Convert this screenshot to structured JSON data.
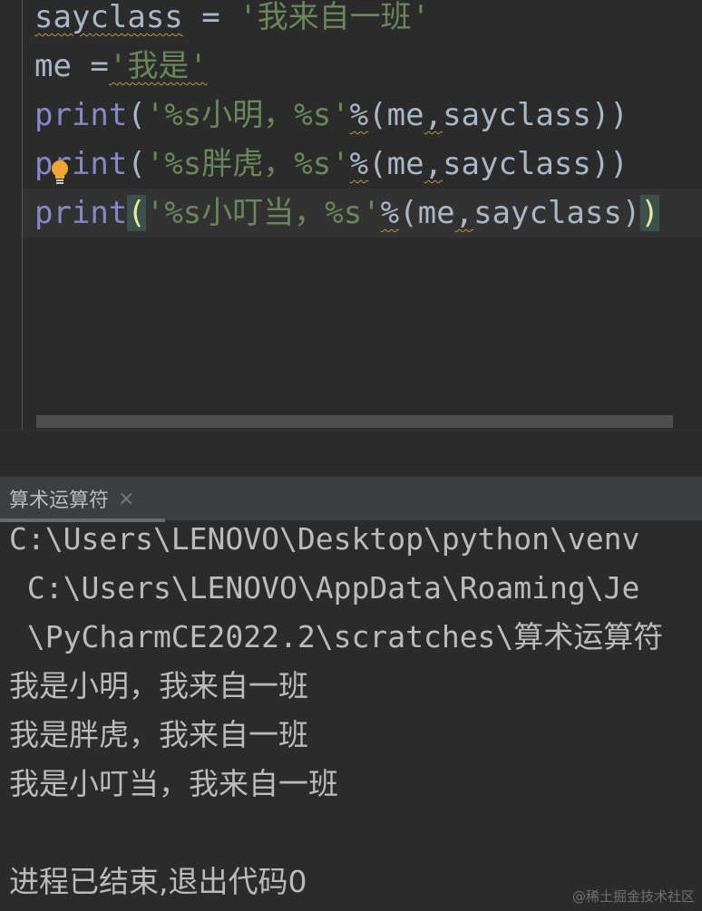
{
  "editor": {
    "lines": [
      {
        "parts": [
          {
            "t": "sayclass",
            "c": "id",
            "sq": true
          },
          {
            "t": " = ",
            "c": "id"
          },
          {
            "t": "'我来自一班'",
            "c": "str"
          }
        ]
      },
      {
        "parts": [
          {
            "t": "me",
            "c": "id"
          },
          {
            "t": " =",
            "c": "id"
          },
          {
            "t": "'我是'",
            "c": "str",
            "sq": true
          }
        ]
      },
      {
        "parts": [
          {
            "t": "print",
            "c": "kw"
          },
          {
            "t": "(",
            "c": "id"
          },
          {
            "t": "'%s小明，%s'",
            "c": "str"
          },
          {
            "t": "%",
            "c": "id",
            "sq": true
          },
          {
            "t": "(me",
            "c": "id"
          },
          {
            "t": ",",
            "c": "id",
            "sq": true
          },
          {
            "t": "sayclass))",
            "c": "id"
          }
        ]
      },
      {
        "parts": [
          {
            "t": "print",
            "c": "kw"
          },
          {
            "t": "(",
            "c": "id"
          },
          {
            "t": "'%s胖虎，%s'",
            "c": "str"
          },
          {
            "t": "%",
            "c": "id",
            "sq": true
          },
          {
            "t": "(me",
            "c": "id"
          },
          {
            "t": ",",
            "c": "id",
            "sq": true
          },
          {
            "t": "sayclass))",
            "c": "id"
          }
        ]
      },
      {
        "current": true,
        "parts": [
          {
            "t": "print",
            "c": "kw"
          },
          {
            "t": "(",
            "c": "brace"
          },
          {
            "t": "'%s小叮当，%s'",
            "c": "str"
          },
          {
            "t": "%",
            "c": "id",
            "sq": true
          },
          {
            "t": "(me",
            "c": "id"
          },
          {
            "t": ",",
            "c": "id",
            "sq": true
          },
          {
            "t": "sayclass)",
            "c": "id"
          },
          {
            "t": ")",
            "c": "brace"
          }
        ]
      }
    ]
  },
  "run_panel": {
    "tab_label": "算术运算符",
    "tab_close": "×"
  },
  "console": {
    "lines": [
      "C:\\Users\\LENOVO\\Desktop\\python\\venv",
      " C:\\Users\\LENOVO\\AppData\\Roaming\\Je",
      " \\PyCharmCE2022.2\\scratches\\算术运算符",
      "我是小明，我来自一班",
      "我是胖虎，我来自一班",
      "我是小叮当，我来自一班",
      "",
      "进程已结束,退出代码0"
    ]
  },
  "watermark": "@稀土掘金技术社区",
  "colors": {
    "background": "#2b2b2b",
    "keyword": "#8888c6",
    "string": "#6a8759",
    "identifier": "#a9b7c6",
    "warning_squiggle": "#b99b36",
    "bulb": "#f0a732"
  },
  "icons": {
    "intention": "lightbulb-icon"
  }
}
